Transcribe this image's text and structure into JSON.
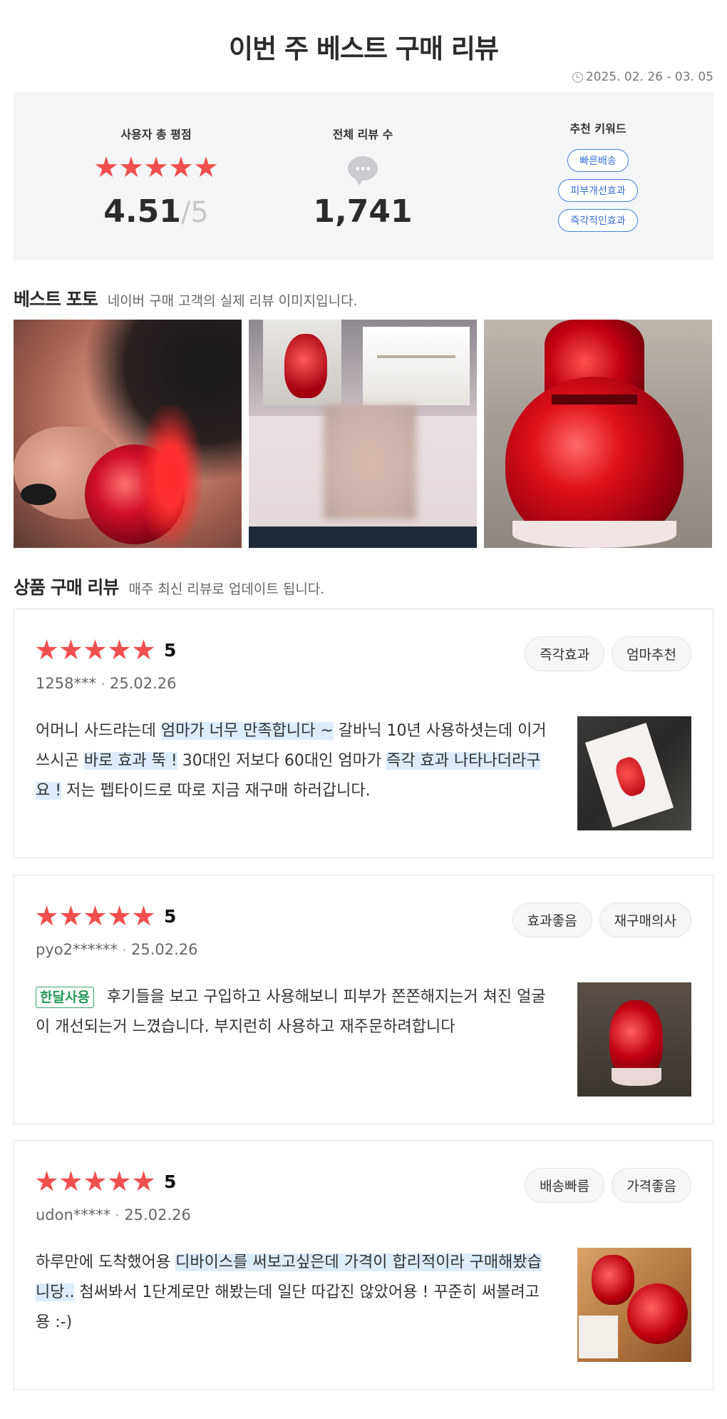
{
  "title": "이번 주 베스트 구매 리뷰",
  "period": "2025. 02. 26 - 03. 05",
  "summary": {
    "rating_label": "사용자 총 평점",
    "rating_value": "4.51",
    "rating_slash": "/",
    "rating_max": "5",
    "rating_stars": 5,
    "count_label": "전체 리뷰 수",
    "count_value": "1,741",
    "keyword_label": "추천 키워드",
    "keywords": [
      "빠른배송",
      "피부개선효과",
      "즉각적인효과"
    ]
  },
  "photo_section": {
    "heading": "베스트 포토",
    "subtitle": "네이버 구매 고객의 실제 리뷰 이미지입니다."
  },
  "review_section": {
    "heading": "상품 구매 리뷰",
    "subtitle": "매주 최신 리뷰로 업데이트 됩니다."
  },
  "reviews": [
    {
      "score": "5",
      "user": "1258***",
      "date": "25.02.26",
      "tags": [
        "즉각효과",
        "엄마추천"
      ],
      "body": [
        {
          "t": "어머니 사드랴는데 ",
          "hl": false
        },
        {
          "t": "엄마가 너무 만족합니다 ~",
          "hl": true
        },
        {
          "t": " 갈바닉 10년 사용하셧는데 이거 쓰시곤 ",
          "hl": false
        },
        {
          "t": "바로 효과 뚝 !",
          "hl": true
        },
        {
          "t": " 30대인 저보다 60대인 엄마가 ",
          "hl": false
        },
        {
          "t": "즉각 효과 나타나더라구요 !",
          "hl": true
        },
        {
          "t": " 저는 펩타이드로 따로 지금 재구매 하러갑니다.",
          "hl": false
        }
      ]
    },
    {
      "score": "5",
      "user": "pyo2******",
      "date": "25.02.26",
      "tags": [
        "효과좋음",
        "재구매의사"
      ],
      "badge": "한달사용",
      "body": [
        {
          "t": "후기들을 보고 구입하고 사용해보니 피부가 쫀쫀해지는거 쳐진 얼굴이 개선되는거 느꼈습니다. 부지런히 사용하고 재주문하려합니다",
          "hl": false
        }
      ]
    },
    {
      "score": "5",
      "user": "udon*****",
      "date": "25.02.26",
      "tags": [
        "배송빠름",
        "가격좋음"
      ],
      "body": [
        {
          "t": "하루만에 도착했어용 ",
          "hl": false
        },
        {
          "t": "디바이스를 써보고싶은데 가격이 합리적이라 구매해봤습니당..",
          "hl": true
        },
        {
          "t": " 첨써봐서 1단계로만 해봤는데 일단 따갑진 않았어용 ! 꾸준히 써볼려고용 :-)",
          "hl": false
        }
      ]
    }
  ]
}
